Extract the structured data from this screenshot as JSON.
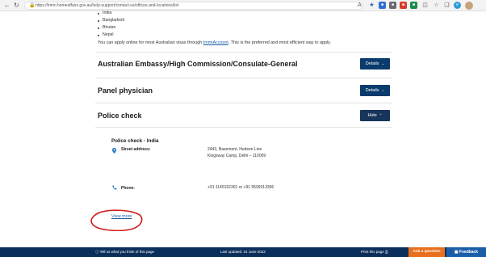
{
  "browser": {
    "url": "https://immi.homeaffairs.gov.au/help-support/contact-us/offices-and-locations/list",
    "icons": [
      "back-icon",
      "refresh-icon",
      "lock-icon",
      "star-icon",
      "extension-icon",
      "collections-icon",
      "profile-icon"
    ]
  },
  "content": {
    "countries": [
      "India",
      "Bangladesh",
      "Bhutan",
      "Nepal"
    ],
    "apply_prefix": "You can apply online for most Australian visas through ",
    "apply_link": "ImmiAccount",
    "apply_suffix": ". This is the preferred and most efficient way to apply."
  },
  "sections": {
    "embassy": {
      "title": "Australian Embassy/High Commission/Consulate-General",
      "button": "Details"
    },
    "panel": {
      "title": "Panel physician",
      "button": "Details"
    },
    "police": {
      "title": "Police check",
      "button": "Hide"
    }
  },
  "police_check": {
    "heading": "Police check - India",
    "address_label": "Street address:",
    "address_line1": "2443, Basement, Hudson Line",
    "address_line2": "Kingsway Camp, Delhi – 110009",
    "phone_label": "Phone:",
    "phone_value": "+91 1145152301  or +91 9599313306",
    "view_more": "View more"
  },
  "footer": {
    "tell_us": "Tell us what you think of this page",
    "last_updated": "Last updated: 24 June 2022",
    "print": "Print this page",
    "ask": "Ask a question",
    "feedback": "Feedback"
  },
  "colors": {
    "primary_button": "#0b3b6d",
    "footer_bg": "#0b2f5b",
    "ask_button": "#e8701f",
    "feedback_button": "#1a5ea8",
    "annotation": "#d41e1e"
  }
}
